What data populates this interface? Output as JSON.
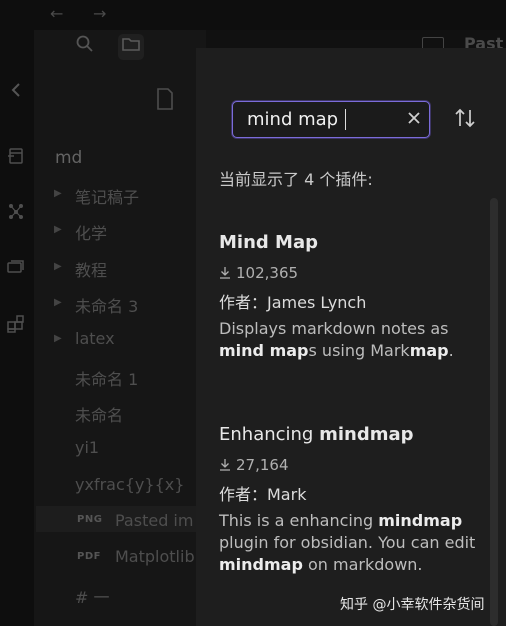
{
  "app": {
    "nav_back": "←",
    "nav_forward": "→",
    "right_tab_label": "Past"
  },
  "sidebar": {
    "vault_name": "md",
    "folders": [
      {
        "label": "笔记稿子"
      },
      {
        "label": "化学"
      },
      {
        "label": "教程"
      },
      {
        "label": "未命名 3"
      },
      {
        "label": "latex"
      }
    ],
    "files": [
      {
        "label": "未命名 1"
      },
      {
        "label": "未命名"
      },
      {
        "label": "yi1"
      },
      {
        "label": "yxfrac{y}{x}"
      }
    ],
    "attachments": [
      {
        "badge": "PNG",
        "label": "Pasted im"
      },
      {
        "badge": "PDF",
        "label": "Matplotlib"
      }
    ],
    "last_item": "# 一"
  },
  "panel": {
    "search": {
      "value": "mind map",
      "placeholder": ""
    },
    "result_count": "当前显示了 4 个插件:",
    "plugins": [
      {
        "title_plain": "",
        "title_bold": "Mind Map",
        "downloads": "102,365",
        "author": "作者：James Lynch",
        "desc": [
          {
            "t": "Displays markdown notes as ",
            "b": false
          },
          {
            "t": "mind map",
            "b": true
          },
          {
            "t": "s using Mark",
            "b": false
          },
          {
            "t": "map",
            "b": true
          },
          {
            "t": ".",
            "b": false
          }
        ]
      },
      {
        "title_plain": "Enhancing ",
        "title_bold": "mindmap",
        "downloads": "27,164",
        "author": "作者：Mark",
        "desc": [
          {
            "t": "This is a enhancing ",
            "b": false
          },
          {
            "t": "mindmap",
            "b": true
          },
          {
            "t": " plugin for obsidian. You can edit ",
            "b": false
          },
          {
            "t": "mindmap",
            "b": true
          },
          {
            "t": " on markdown.",
            "b": false
          }
        ]
      }
    ]
  },
  "watermark": "知乎 @小幸软件杂货间",
  "colors": {
    "accent": "#7b6cd9",
    "panel_bg": "#1e1e1e",
    "sidebar_bg": "#161616"
  }
}
